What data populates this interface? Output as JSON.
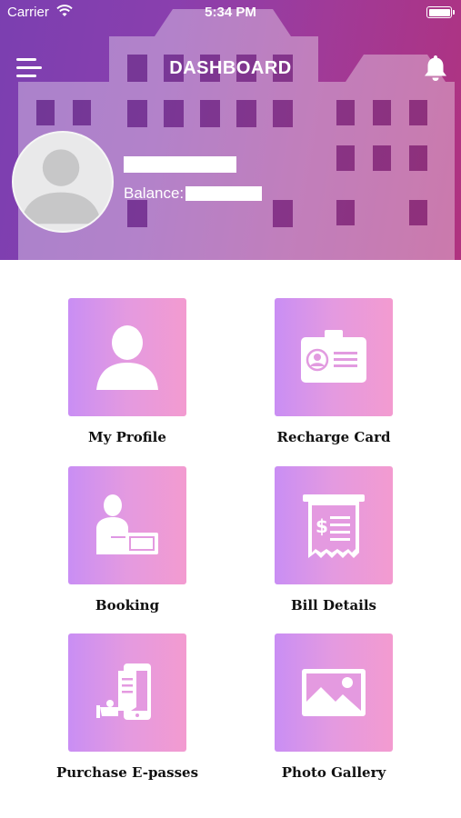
{
  "status_bar": {
    "carrier": "Carrier",
    "time": "5:34 PM"
  },
  "header": {
    "title": "DASHBOARD",
    "user_name": "",
    "balance_label": "Balance:",
    "balance_value": ""
  },
  "tiles": [
    {
      "label": "My Profile",
      "icon": "profile-icon"
    },
    {
      "label": "Recharge Card",
      "icon": "id-card-icon"
    },
    {
      "label": "Booking",
      "icon": "booking-icon"
    },
    {
      "label": "Bill Details",
      "icon": "bill-receipt-icon"
    },
    {
      "label": "Purchase E-passes",
      "icon": "e-pass-phone-icon"
    },
    {
      "label": "Photo Gallery",
      "icon": "gallery-image-icon"
    }
  ],
  "colors": {
    "header_gradient_start": "#7b3fb0",
    "header_gradient_end": "#b0327f",
    "tile_gradient_start": "#c98ef4",
    "tile_gradient_end": "#f39bd0"
  }
}
